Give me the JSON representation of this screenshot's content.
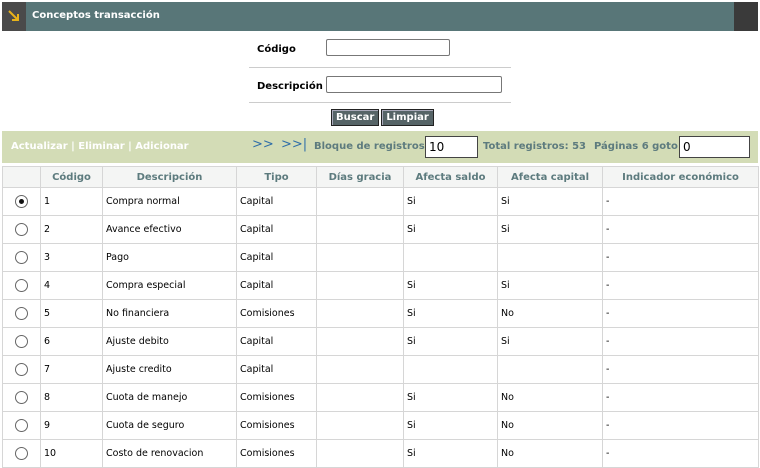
{
  "header": {
    "title": "Conceptos transacción",
    "icon": "expand-icon"
  },
  "search": {
    "codigo_label": "Código",
    "codigo_value": "",
    "descripcion_label": "Descripción",
    "descripcion_value": "",
    "buscar": "Buscar",
    "limpiar": "Limpiar"
  },
  "toolbar": {
    "actualizar": "Actualizar",
    "eliminar": "Eliminar",
    "adicionar": "Adicionar",
    "sep": " | ",
    "next": ">>",
    "last": ">>|",
    "bloque_label": "Bloque de registros:",
    "bloque_value": "10",
    "total_label": "Total registros: 53",
    "paginas_label": "Páginas 6 goto:",
    "goto_value": "0"
  },
  "table": {
    "columns": [
      "",
      "Código",
      "Descripción",
      "Tipo",
      "Días gracia",
      "Afecta saldo",
      "Afecta capital",
      "Indicador económico"
    ],
    "rows": [
      {
        "selected": true,
        "codigo": "1",
        "descripcion": "Compra normal",
        "tipo": "Capital",
        "dias": "",
        "saldo": "Si",
        "capital": "Si",
        "indicador": "-"
      },
      {
        "selected": false,
        "codigo": "2",
        "descripcion": "Avance efectivo",
        "tipo": "Capital",
        "dias": "",
        "saldo": "Si",
        "capital": "Si",
        "indicador": "-"
      },
      {
        "selected": false,
        "codigo": "3",
        "descripcion": "Pago",
        "tipo": "Capital",
        "dias": "",
        "saldo": "",
        "capital": "",
        "indicador": "-"
      },
      {
        "selected": false,
        "codigo": "4",
        "descripcion": "Compra especial",
        "tipo": "Capital",
        "dias": "",
        "saldo": "Si",
        "capital": "Si",
        "indicador": "-"
      },
      {
        "selected": false,
        "codigo": "5",
        "descripcion": "No financiera",
        "tipo": "Comisiones",
        "dias": "",
        "saldo": "Si",
        "capital": "No",
        "indicador": "-"
      },
      {
        "selected": false,
        "codigo": "6",
        "descripcion": "Ajuste debito",
        "tipo": "Capital",
        "dias": "",
        "saldo": "Si",
        "capital": "Si",
        "indicador": "-"
      },
      {
        "selected": false,
        "codigo": "7",
        "descripcion": "Ajuste credito",
        "tipo": "Capital",
        "dias": "",
        "saldo": "",
        "capital": "",
        "indicador": "-"
      },
      {
        "selected": false,
        "codigo": "8",
        "descripcion": "Cuota de manejo",
        "tipo": "Comisiones",
        "dias": "",
        "saldo": "Si",
        "capital": "No",
        "indicador": "-"
      },
      {
        "selected": false,
        "codigo": "9",
        "descripcion": "Cuota de seguro",
        "tipo": "Comisiones",
        "dias": "",
        "saldo": "Si",
        "capital": "No",
        "indicador": "-"
      },
      {
        "selected": false,
        "codigo": "10",
        "descripcion": "Costo de renovacion",
        "tipo": "Comisiones",
        "dias": "",
        "saldo": "Si",
        "capital": "No",
        "indicador": "-"
      }
    ]
  },
  "colors": {
    "title_bar": "#587678",
    "toolbar_bg": "#d3dcb6",
    "header_text": "#5d7b7e",
    "nav_blue": "#2f6ea8",
    "button_bg": "#566467"
  }
}
